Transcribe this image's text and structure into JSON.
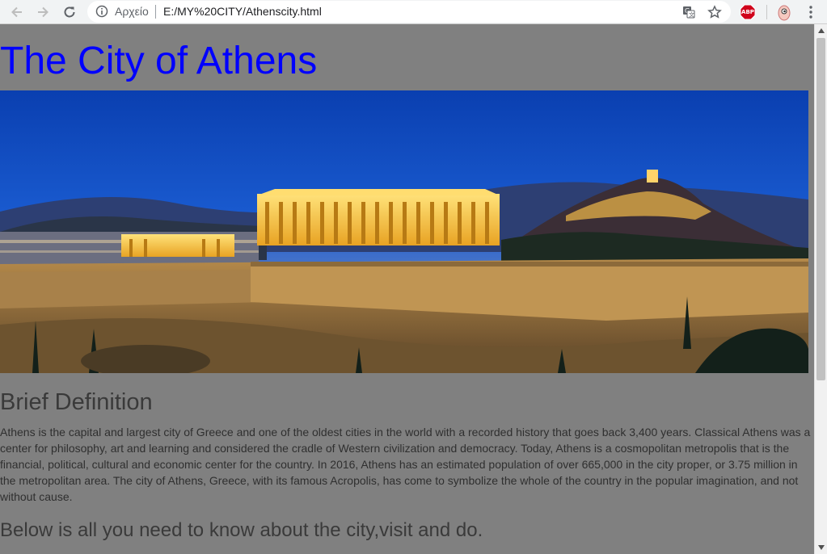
{
  "browser": {
    "scheme_label": "Αρχείο",
    "url": "E:/MY%20CITY/Athenscity.html",
    "icons": [
      "back-arrow-icon",
      "forward-arrow-icon",
      "reload-icon",
      "info-icon",
      "translate-icon",
      "star-icon",
      "adblock-plus-icon",
      "profile-avatar-icon",
      "more-menu-icon"
    ],
    "adblock_label": "ABP",
    "adblock_color": "#d0021b"
  },
  "page": {
    "title": "The City of Athens",
    "title_color": "#0000ff",
    "background_color": "#808080",
    "hero_image": "acropolis-night-panorama",
    "section_heading": "Brief Definition",
    "paragraph": "Athens is the capital and largest city of Greece and one of the oldest cities in the world with a recorded history that goes back 3,400 years. Classical Athens was a center for philosophy, art and learning and considered the cradle of Western civilization and democracy. Today, Athens is a cosmopolitan metropolis that is the financial, political, cultural and economic center for the country. In 2016, Athens has an estimated population of over 665,000 in the city proper, or 3.75 million in the metropolitan area. The city of Athens, Greece, with its famous Acropolis, has come to symbolize the whole of the country in the popular imagination, and not without cause.",
    "subheading": "Below is all you need to know about the city,visit and do."
  }
}
